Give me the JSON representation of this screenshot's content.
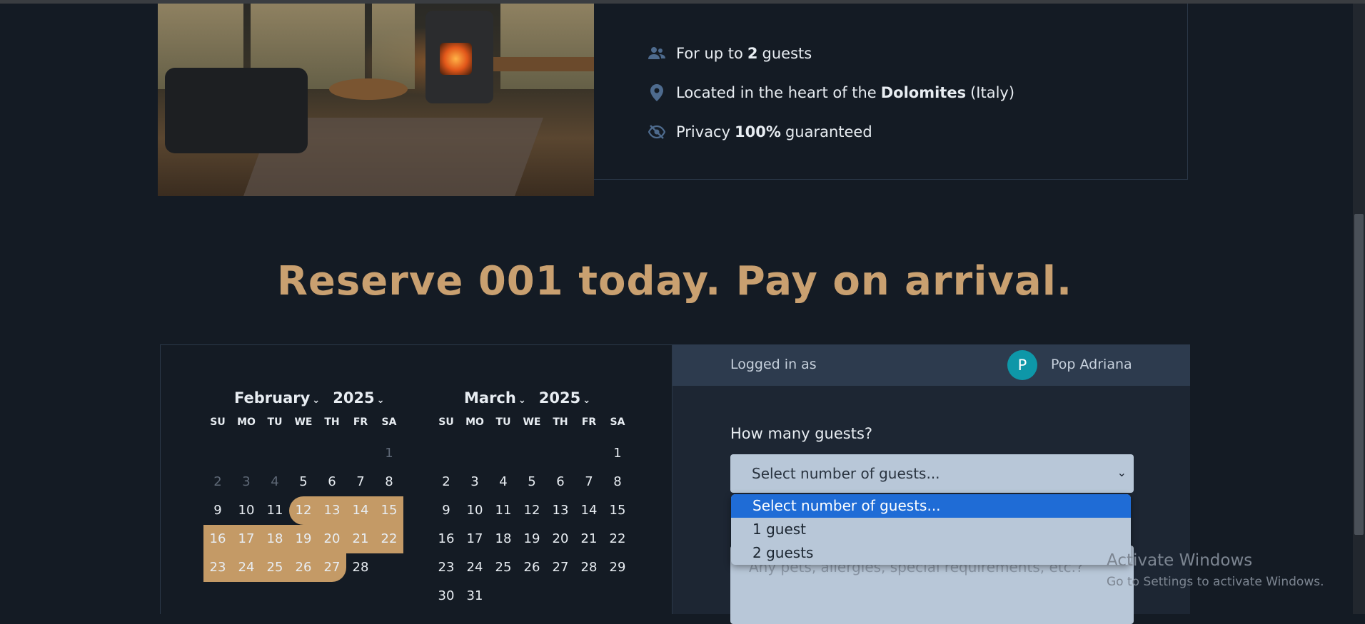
{
  "features": {
    "guests": {
      "prefix": "For up to",
      "value": "2",
      "suffix": "guests"
    },
    "location": {
      "prefix": "Located in the heart of the",
      "value": "Dolomites",
      "suffix": "(Italy)"
    },
    "privacy": {
      "prefix": "Privacy",
      "value": "100%",
      "suffix": "guaranteed"
    }
  },
  "headline": "Reserve 001 today. Pay on arrival.",
  "calendar": {
    "weekdays": [
      "SU",
      "MO",
      "TU",
      "WE",
      "TH",
      "FR",
      "SA"
    ],
    "months": [
      {
        "month": "February",
        "year": "2025",
        "first_weekday": 6,
        "days": 28,
        "disabled_through": 4,
        "selected_from": 12,
        "selected_to": 27,
        "prev_month_trailing": [
          2,
          3,
          4
        ]
      },
      {
        "month": "March",
        "year": "2025",
        "first_weekday": 6,
        "days": 31
      }
    ]
  },
  "session": {
    "logged_in_label": "Logged in as",
    "avatar_initial": "P",
    "user_name": "Pop Adriana"
  },
  "form": {
    "guests_question": "How many guests?",
    "guests_select_value": "Select number of guests...",
    "guests_options": [
      "Select number of guests...",
      "1 guest",
      "2 guests"
    ],
    "notes_placeholder": "Any pets, allergies, special requirements, etc.?"
  },
  "watermark": {
    "title": "Activate Windows",
    "subtitle": "Go to Settings to activate Windows."
  },
  "colors": {
    "accent": "#c9a070",
    "background": "#141b24",
    "select_highlight": "#1f6cd6"
  }
}
